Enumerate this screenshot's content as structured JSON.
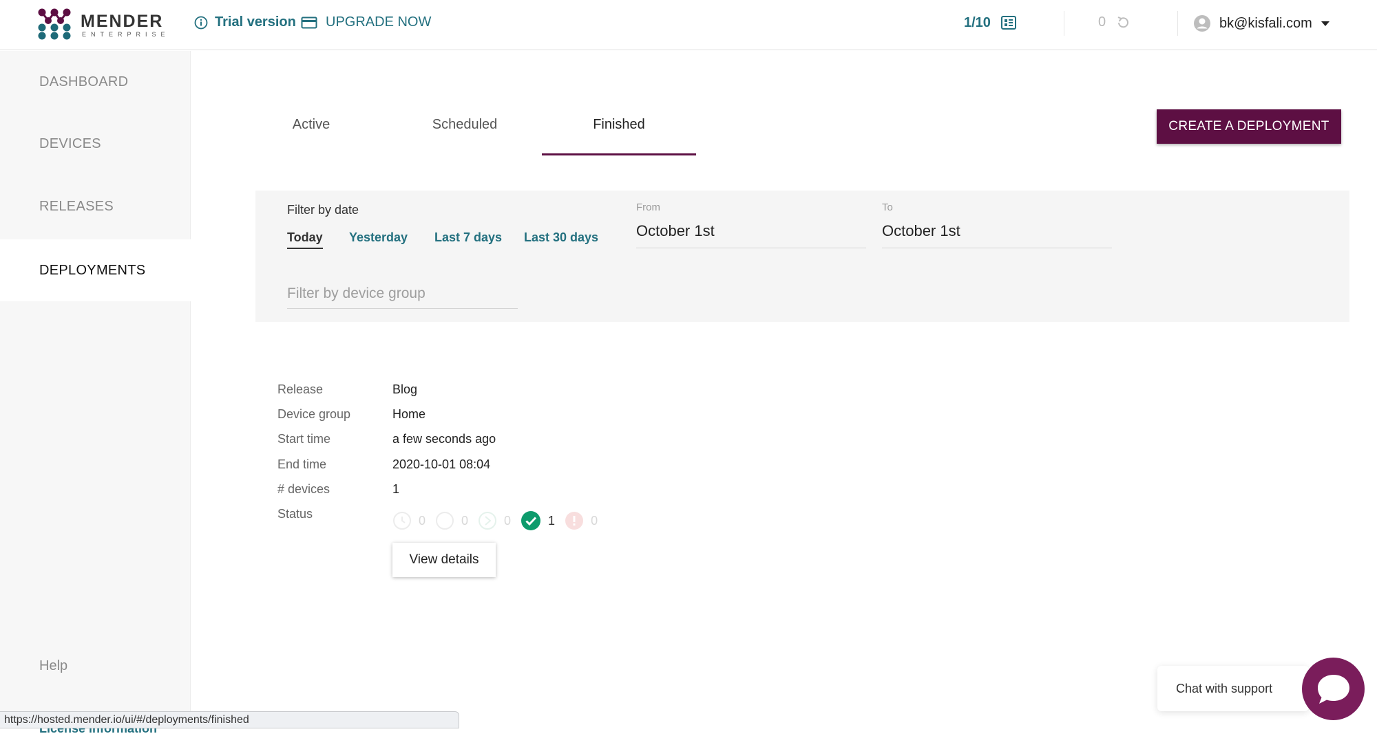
{
  "header": {
    "logo_word": "MENDER",
    "logo_sub": "ENTERPRISE",
    "trial_label": "Trial version",
    "upgrade_label": "UPGRADE NOW",
    "device_count": "1/10",
    "pending_count": "0",
    "user_email": "bk@kisfali.com"
  },
  "sidebar": {
    "items": [
      {
        "label": "DASHBOARD"
      },
      {
        "label": "DEVICES"
      },
      {
        "label": "RELEASES"
      },
      {
        "label": "DEPLOYMENTS"
      }
    ],
    "help_label": "Help",
    "license_label": "License information"
  },
  "tabs": [
    {
      "label": "Active"
    },
    {
      "label": "Scheduled"
    },
    {
      "label": "Finished"
    }
  ],
  "create_button_label": "CREATE A DEPLOYMENT",
  "filter": {
    "title": "Filter by date",
    "ranges": [
      "Today",
      "Yesterday",
      "Last 7 days",
      "Last 30 days"
    ],
    "from_label": "From",
    "from_value": "October 1st",
    "to_label": "To",
    "to_value": "October 1st",
    "group_placeholder": "Filter by device group"
  },
  "deployment": {
    "labels": [
      "Release",
      "Device group",
      "Start time",
      "End time",
      "# devices",
      "Status"
    ],
    "release": "Blog",
    "device_group": "Home",
    "start_time": "a few seconds ago",
    "end_time": "2020-10-01 08:04",
    "devices": "1",
    "status_counts": [
      "0",
      "0",
      "0",
      "1",
      "0"
    ],
    "view_details_label": "View details"
  },
  "chat": {
    "label": "Chat with support"
  },
  "status_url": "https://hosted.mender.io/ui/#/deployments/finished",
  "colors": {
    "accent_teal": "#23707f",
    "brand_purple": "#5d0f43",
    "success_green": "#0d9b6c",
    "chat_purple": "#7a1d5b"
  }
}
